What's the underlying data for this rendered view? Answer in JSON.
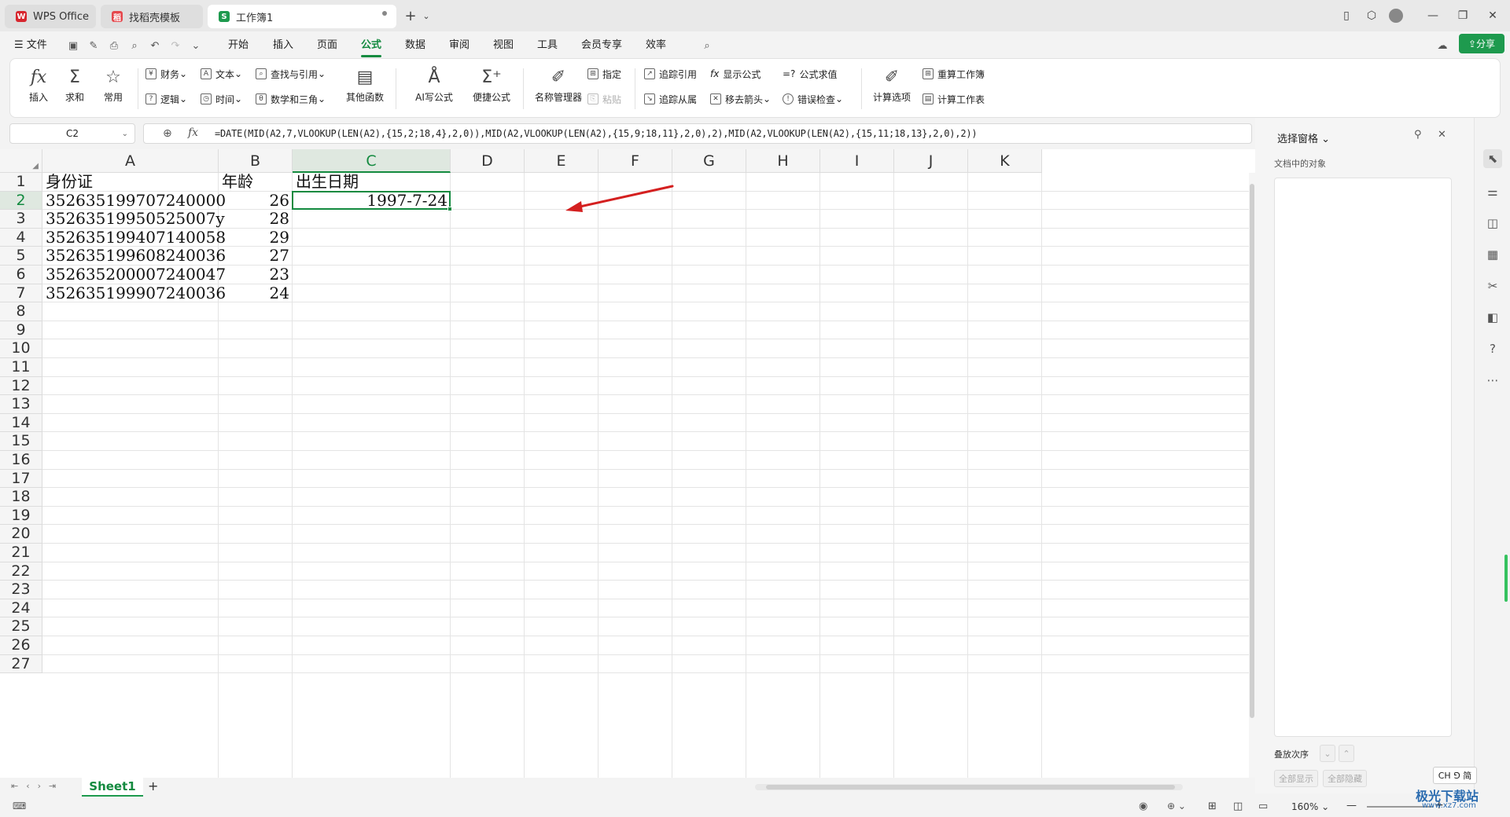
{
  "titlebar": {
    "tabs": [
      {
        "label": "WPS Office",
        "color": "#d7262e",
        "glyph": "W"
      },
      {
        "label": "找稻壳模板",
        "color": "#e5484d",
        "glyph": "稻"
      },
      {
        "label": "工作簿1",
        "color": "#1e9a4e",
        "glyph": "S"
      }
    ],
    "new_tab": "+",
    "tab_menu": "⌄"
  },
  "menubar": {
    "file": "文件",
    "items": [
      "开始",
      "插入",
      "页面",
      "公式",
      "数据",
      "审阅",
      "视图",
      "工具",
      "会员专享",
      "效率"
    ],
    "active": "公式",
    "share": "分享"
  },
  "ribbon": {
    "insert": "插入",
    "sum": "求和",
    "common": "常用",
    "finance": "财务",
    "text": "文本",
    "lookup": "查找与引用",
    "logic": "逻辑",
    "time": "时间",
    "math": "数学和三角",
    "other": "其他函数",
    "ai_formula": "AI写公式",
    "quick_formula": "便捷公式",
    "name_manager": "名称管理器",
    "specify": "指定",
    "paste": "粘贴",
    "trace_precedents": "追踪引用",
    "show_formula": "显示公式",
    "evaluate": "公式求值",
    "trace_dependents": "追踪从属",
    "remove_arrows": "移去箭头",
    "error_check": "错误检查",
    "calc_options": "计算选项",
    "recalc_workbook": "重算工作簿",
    "calc_sheet": "计算工作表"
  },
  "formula_bar": {
    "name_box": "C2",
    "fx": "fx",
    "formula": "=DATE(MID(A2,7,VLOOKUP(LEN(A2),{15,2;18,4},2,0)),MID(A2,VLOOKUP(LEN(A2),{15,9;18,11},2,0),2),MID(A2,VLOOKUP(LEN(A2),{15,11;18,13},2,0),2))"
  },
  "grid": {
    "columns": [
      "A",
      "B",
      "C",
      "D",
      "E",
      "F",
      "G",
      "H",
      "I",
      "J",
      "K"
    ],
    "rows": [
      "1",
      "2",
      "3",
      "4",
      "5",
      "6",
      "7",
      "8",
      "9",
      "10",
      "11",
      "12",
      "13",
      "14",
      "15",
      "16",
      "17",
      "18",
      "19",
      "20",
      "21",
      "22",
      "23",
      "24",
      "25",
      "26",
      "27"
    ],
    "headers": {
      "A": "身份证",
      "B": "年龄",
      "C": "出生日期"
    },
    "data": [
      {
        "id": "352635199707240000",
        "age": "26",
        "birth": "1997-7-24"
      },
      {
        "id": "35263519950525007y",
        "age": "28",
        "birth": ""
      },
      {
        "id": "352635199407140058",
        "age": "29",
        "birth": ""
      },
      {
        "id": "352635199608240036",
        "age": "27",
        "birth": ""
      },
      {
        "id": "352635200007240047",
        "age": "23",
        "birth": ""
      },
      {
        "id": "352635199907240036",
        "age": "24",
        "birth": ""
      }
    ],
    "selected_cell": "C2"
  },
  "selection_pane": {
    "title": "选择窗格",
    "objects_label": "文档中的对象",
    "stack_order": "叠放次序",
    "show_all": "全部显示",
    "hide_all": "全部隐藏"
  },
  "sheet_tabs": {
    "sheets": [
      "Sheet1"
    ],
    "add": "+"
  },
  "statusbar": {
    "zoom": "160%",
    "ime": "CH ⅁ 简",
    "watermark": "极光下载站",
    "watermark_url": "www.xz7.com"
  },
  "colors": {
    "accent": "#138a3f",
    "arrow": "#d42020"
  }
}
